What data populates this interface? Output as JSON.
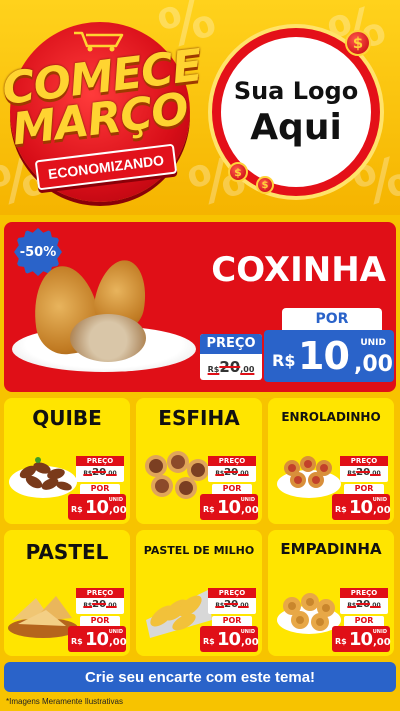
{
  "header": {
    "title_line1": "COMECE",
    "title_line2": "MARÇO",
    "ribbon": "ECONOMIZANDO",
    "logo_line1": "Sua Logo",
    "logo_line2": "Aqui",
    "coin_symbol": "$",
    "bg_symbol": "%"
  },
  "hero": {
    "discount": "-50%",
    "name": "COXINHA",
    "old_label": "PREÇO",
    "old_currency": "R$",
    "old_int": "20",
    "old_cents": ",00",
    "new_label": "POR",
    "new_currency": "R$",
    "new_int": "10",
    "new_cents": ",00",
    "unit": "UNID"
  },
  "products": [
    {
      "name": "QUIBE",
      "old_label": "PREÇO",
      "old_currency": "R$",
      "old_int": "20",
      "old_cents": ",00",
      "new_label": "POR",
      "new_currency": "R$",
      "new_int": "10",
      "new_cents": ",00",
      "unit": "UNID"
    },
    {
      "name": "ESFIHA",
      "old_label": "PREÇO",
      "old_currency": "R$",
      "old_int": "20",
      "old_cents": ",00",
      "new_label": "POR",
      "new_currency": "R$",
      "new_int": "10",
      "new_cents": ",00",
      "unit": "UNID"
    },
    {
      "name": "ENROLADINHO",
      "old_label": "PREÇO",
      "old_currency": "R$",
      "old_int": "20",
      "old_cents": ",00",
      "new_label": "POR",
      "new_currency": "R$",
      "new_int": "10",
      "new_cents": ",00",
      "unit": "UNID"
    },
    {
      "name": "PASTEL",
      "old_label": "PREÇO",
      "old_currency": "R$",
      "old_int": "20",
      "old_cents": ",00",
      "new_label": "POR",
      "new_currency": "R$",
      "new_int": "10",
      "new_cents": ",00",
      "unit": "UNID"
    },
    {
      "name": "PASTEL DE MILHO",
      "old_label": "PREÇO",
      "old_currency": "R$",
      "old_int": "20",
      "old_cents": ",00",
      "new_label": "POR",
      "new_currency": "R$",
      "new_int": "10",
      "new_cents": ",00",
      "unit": "UNID"
    },
    {
      "name": "EMPADINHA",
      "old_label": "PREÇO",
      "old_currency": "R$",
      "old_int": "20",
      "old_cents": ",00",
      "new_label": "POR",
      "new_currency": "R$",
      "new_int": "10",
      "new_cents": ",00",
      "unit": "UNID"
    }
  ],
  "footer": {
    "cta": "Crie seu encarte com este tema!",
    "disclaimer": "*Imagens Meramente Ilustrativas"
  },
  "colors": {
    "background": "#f7c300",
    "card": "#ffe500",
    "red": "#e00f17",
    "blue": "#2a63c9"
  }
}
